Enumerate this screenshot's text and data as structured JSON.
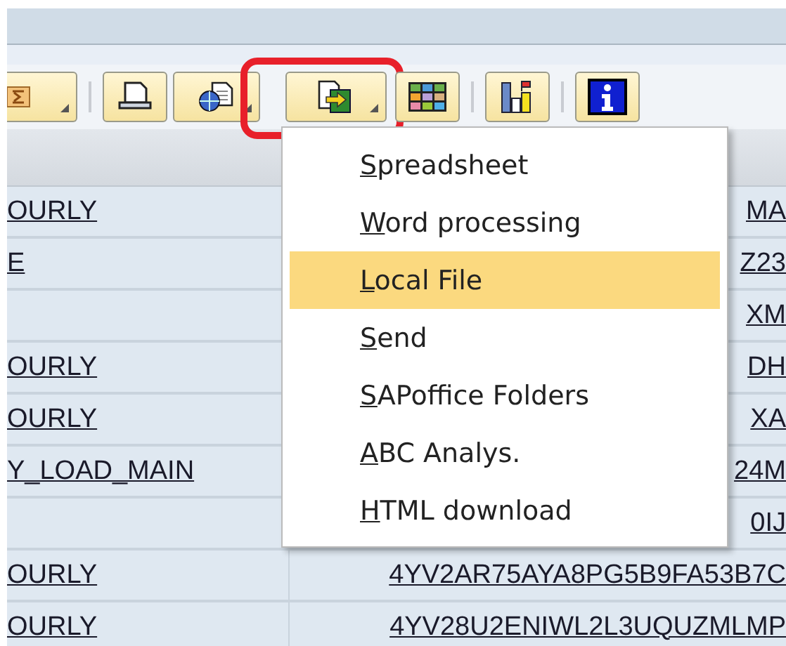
{
  "toolbar": {
    "buttons": [
      {
        "kind": "sum",
        "dropdown": true,
        "highlighted": false
      },
      {
        "kind": "sep"
      },
      {
        "kind": "print",
        "dropdown": false,
        "highlighted": false
      },
      {
        "kind": "views",
        "dropdown": true,
        "highlighted": false
      },
      {
        "kind": "export",
        "dropdown": true,
        "highlighted": true
      },
      {
        "kind": "grid",
        "dropdown": false,
        "highlighted": false
      },
      {
        "kind": "sep"
      },
      {
        "kind": "chart",
        "dropdown": false,
        "highlighted": false
      },
      {
        "kind": "sep"
      },
      {
        "kind": "info",
        "dropdown": false,
        "highlighted": false
      }
    ]
  },
  "table": {
    "rows": [
      {
        "column_1": "OURLY",
        "column_2": "MA"
      },
      {
        "column_1": "E",
        "column_2": "Z23"
      },
      {
        "column_1": "",
        "column_2": "XM"
      },
      {
        "column_1": "OURLY",
        "column_2": "DH"
      },
      {
        "column_1": "OURLY",
        "column_2": "XA"
      },
      {
        "column_1": "Y_LOAD_MAIN",
        "column_2": "24M"
      },
      {
        "column_1": "",
        "column_2": "0IJ"
      },
      {
        "column_1": "OURLY",
        "column_2": "4YV2AR75AYA8PG5B9FA53B7C"
      },
      {
        "column_1": "OURLY",
        "column_2": "4YV28U2ENIWL2L3UQUZMLMP"
      }
    ]
  },
  "export_menu": {
    "items": [
      {
        "accel": "S",
        "rest": "preadsheet",
        "selected": false
      },
      {
        "accel": "W",
        "rest": "ord processing",
        "selected": false
      },
      {
        "accel": "L",
        "rest": "ocal File",
        "selected": true
      },
      {
        "accel": "S",
        "rest": "end",
        "selected": false
      },
      {
        "accel": "S",
        "rest": "APoffice Folders",
        "selected": false
      },
      {
        "accel": "A",
        "rest": "BC Analys.",
        "selected": false
      },
      {
        "accel": "H",
        "rest": "TML download",
        "selected": false
      }
    ]
  }
}
